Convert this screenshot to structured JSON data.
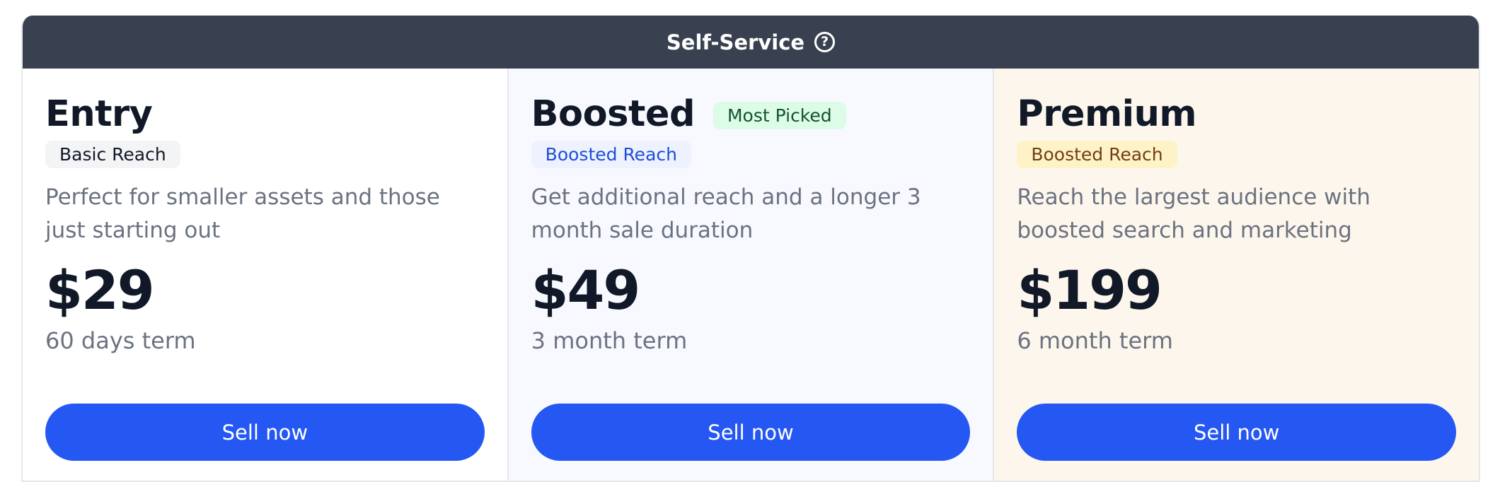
{
  "header": {
    "title": "Self-Service",
    "help_icon": "question-circle-icon",
    "help_glyph": "?"
  },
  "colors": {
    "header_bg": "#394150",
    "button_bg": "#2558f3",
    "popular_badge_bg": "#dcfce7",
    "premium_bg": "#fdf6ec"
  },
  "tiers": [
    {
      "name": "Entry",
      "reach": "Basic Reach",
      "description": "Perfect for smaller assets and those just starting out",
      "price": "$29",
      "term": "60 days term",
      "button_label": "Sell now"
    },
    {
      "name": "Boosted",
      "badge": "Most Picked",
      "reach": "Boosted Reach",
      "description": "Get additional reach and a longer 3 month sale duration",
      "price": "$49",
      "term": "3 month term",
      "button_label": "Sell now"
    },
    {
      "name": "Premium",
      "reach": "Boosted Reach",
      "description": "Reach the largest audience with boosted search and marketing",
      "price": "$199",
      "term": "6 month term",
      "button_label": "Sell now"
    }
  ]
}
